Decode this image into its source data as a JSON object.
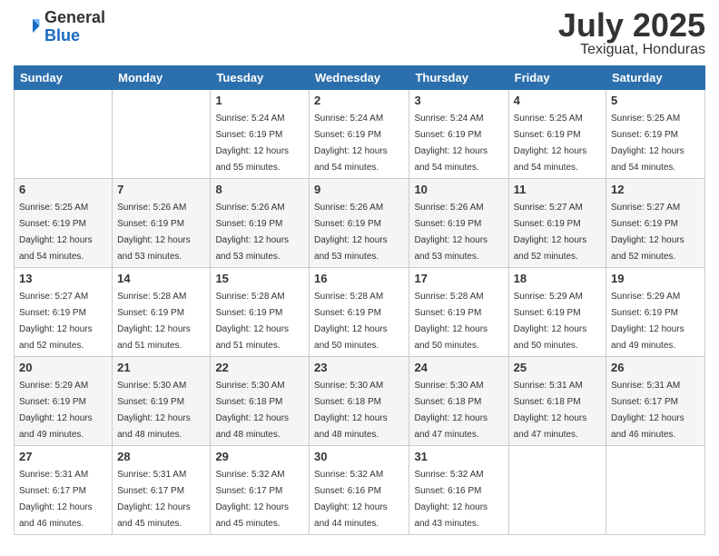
{
  "logo": {
    "general": "General",
    "blue": "Blue"
  },
  "title": {
    "month_year": "July 2025",
    "location": "Texiguat, Honduras"
  },
  "days_of_week": [
    "Sunday",
    "Monday",
    "Tuesday",
    "Wednesday",
    "Thursday",
    "Friday",
    "Saturday"
  ],
  "weeks": [
    [
      null,
      null,
      {
        "day": "1",
        "sunrise": "Sunrise: 5:24 AM",
        "sunset": "Sunset: 6:19 PM",
        "daylight": "Daylight: 12 hours and 55 minutes."
      },
      {
        "day": "2",
        "sunrise": "Sunrise: 5:24 AM",
        "sunset": "Sunset: 6:19 PM",
        "daylight": "Daylight: 12 hours and 54 minutes."
      },
      {
        "day": "3",
        "sunrise": "Sunrise: 5:24 AM",
        "sunset": "Sunset: 6:19 PM",
        "daylight": "Daylight: 12 hours and 54 minutes."
      },
      {
        "day": "4",
        "sunrise": "Sunrise: 5:25 AM",
        "sunset": "Sunset: 6:19 PM",
        "daylight": "Daylight: 12 hours and 54 minutes."
      },
      {
        "day": "5",
        "sunrise": "Sunrise: 5:25 AM",
        "sunset": "Sunset: 6:19 PM",
        "daylight": "Daylight: 12 hours and 54 minutes."
      }
    ],
    [
      {
        "day": "6",
        "sunrise": "Sunrise: 5:25 AM",
        "sunset": "Sunset: 6:19 PM",
        "daylight": "Daylight: 12 hours and 54 minutes."
      },
      {
        "day": "7",
        "sunrise": "Sunrise: 5:26 AM",
        "sunset": "Sunset: 6:19 PM",
        "daylight": "Daylight: 12 hours and 53 minutes."
      },
      {
        "day": "8",
        "sunrise": "Sunrise: 5:26 AM",
        "sunset": "Sunset: 6:19 PM",
        "daylight": "Daylight: 12 hours and 53 minutes."
      },
      {
        "day": "9",
        "sunrise": "Sunrise: 5:26 AM",
        "sunset": "Sunset: 6:19 PM",
        "daylight": "Daylight: 12 hours and 53 minutes."
      },
      {
        "day": "10",
        "sunrise": "Sunrise: 5:26 AM",
        "sunset": "Sunset: 6:19 PM",
        "daylight": "Daylight: 12 hours and 53 minutes."
      },
      {
        "day": "11",
        "sunrise": "Sunrise: 5:27 AM",
        "sunset": "Sunset: 6:19 PM",
        "daylight": "Daylight: 12 hours and 52 minutes."
      },
      {
        "day": "12",
        "sunrise": "Sunrise: 5:27 AM",
        "sunset": "Sunset: 6:19 PM",
        "daylight": "Daylight: 12 hours and 52 minutes."
      }
    ],
    [
      {
        "day": "13",
        "sunrise": "Sunrise: 5:27 AM",
        "sunset": "Sunset: 6:19 PM",
        "daylight": "Daylight: 12 hours and 52 minutes."
      },
      {
        "day": "14",
        "sunrise": "Sunrise: 5:28 AM",
        "sunset": "Sunset: 6:19 PM",
        "daylight": "Daylight: 12 hours and 51 minutes."
      },
      {
        "day": "15",
        "sunrise": "Sunrise: 5:28 AM",
        "sunset": "Sunset: 6:19 PM",
        "daylight": "Daylight: 12 hours and 51 minutes."
      },
      {
        "day": "16",
        "sunrise": "Sunrise: 5:28 AM",
        "sunset": "Sunset: 6:19 PM",
        "daylight": "Daylight: 12 hours and 50 minutes."
      },
      {
        "day": "17",
        "sunrise": "Sunrise: 5:28 AM",
        "sunset": "Sunset: 6:19 PM",
        "daylight": "Daylight: 12 hours and 50 minutes."
      },
      {
        "day": "18",
        "sunrise": "Sunrise: 5:29 AM",
        "sunset": "Sunset: 6:19 PM",
        "daylight": "Daylight: 12 hours and 50 minutes."
      },
      {
        "day": "19",
        "sunrise": "Sunrise: 5:29 AM",
        "sunset": "Sunset: 6:19 PM",
        "daylight": "Daylight: 12 hours and 49 minutes."
      }
    ],
    [
      {
        "day": "20",
        "sunrise": "Sunrise: 5:29 AM",
        "sunset": "Sunset: 6:19 PM",
        "daylight": "Daylight: 12 hours and 49 minutes."
      },
      {
        "day": "21",
        "sunrise": "Sunrise: 5:30 AM",
        "sunset": "Sunset: 6:19 PM",
        "daylight": "Daylight: 12 hours and 48 minutes."
      },
      {
        "day": "22",
        "sunrise": "Sunrise: 5:30 AM",
        "sunset": "Sunset: 6:18 PM",
        "daylight": "Daylight: 12 hours and 48 minutes."
      },
      {
        "day": "23",
        "sunrise": "Sunrise: 5:30 AM",
        "sunset": "Sunset: 6:18 PM",
        "daylight": "Daylight: 12 hours and 48 minutes."
      },
      {
        "day": "24",
        "sunrise": "Sunrise: 5:30 AM",
        "sunset": "Sunset: 6:18 PM",
        "daylight": "Daylight: 12 hours and 47 minutes."
      },
      {
        "day": "25",
        "sunrise": "Sunrise: 5:31 AM",
        "sunset": "Sunset: 6:18 PM",
        "daylight": "Daylight: 12 hours and 47 minutes."
      },
      {
        "day": "26",
        "sunrise": "Sunrise: 5:31 AM",
        "sunset": "Sunset: 6:17 PM",
        "daylight": "Daylight: 12 hours and 46 minutes."
      }
    ],
    [
      {
        "day": "27",
        "sunrise": "Sunrise: 5:31 AM",
        "sunset": "Sunset: 6:17 PM",
        "daylight": "Daylight: 12 hours and 46 minutes."
      },
      {
        "day": "28",
        "sunrise": "Sunrise: 5:31 AM",
        "sunset": "Sunset: 6:17 PM",
        "daylight": "Daylight: 12 hours and 45 minutes."
      },
      {
        "day": "29",
        "sunrise": "Sunrise: 5:32 AM",
        "sunset": "Sunset: 6:17 PM",
        "daylight": "Daylight: 12 hours and 45 minutes."
      },
      {
        "day": "30",
        "sunrise": "Sunrise: 5:32 AM",
        "sunset": "Sunset: 6:16 PM",
        "daylight": "Daylight: 12 hours and 44 minutes."
      },
      {
        "day": "31",
        "sunrise": "Sunrise: 5:32 AM",
        "sunset": "Sunset: 6:16 PM",
        "daylight": "Daylight: 12 hours and 43 minutes."
      },
      null,
      null
    ]
  ]
}
